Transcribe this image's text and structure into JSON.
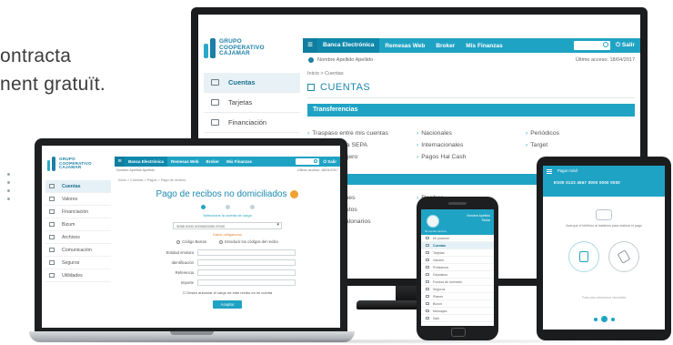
{
  "headline": {
    "line1": "ontracta",
    "line2": "nent gratuït."
  },
  "brand": {
    "name_line1": "GRUPO",
    "name_line2": "COOPERATIVO",
    "name_line3": "CAJAMAR",
    "accent_color": "#1fa3c4",
    "dark_accent_color": "#1c7fa7"
  },
  "monitor": {
    "nav": {
      "menu_icon": "hamburger-icon",
      "items": [
        "Banca Electrónica",
        "Remesas Web",
        "Broker",
        "Mis Finanzas"
      ],
      "exit_label": "Salir",
      "search_icon": "search-icon"
    },
    "user_name": "Nombre Apellido Apellido",
    "last_access": "Último acceso: 18/04/2017",
    "sidebar": [
      {
        "label": "Cuentas",
        "icon": "accounts-icon",
        "active": true
      },
      {
        "label": "Tarjetas",
        "icon": "card-icon",
        "active": false
      },
      {
        "label": "Financiación",
        "icon": "percent-icon",
        "active": false
      }
    ],
    "breadcrumb": "Inicio > Cuentas",
    "page_title": "CUENTAS",
    "section_title": "Transferencias",
    "links_col1": [
      "Traspaso entre mis cuentas",
      "Transferencia SEPA",
      "Dinero en cajero"
    ],
    "links_col2": [
      "Nacionales",
      "Internacionales",
      "Pagos Hal Cash"
    ],
    "links_col3": [
      "Periódicos",
      "Target"
    ],
    "links2_col1": [
      "Domiciliaciones",
      "Pago de tributos",
      "Gestión de talonarios"
    ],
    "links2_col2": [
      "Recibos",
      "Impuestos",
      "Cheques"
    ]
  },
  "laptop": {
    "nav": {
      "items": [
        "Banca Electrónica",
        "Remesas Web",
        "Broker",
        "Mis Finanzas"
      ],
      "exit_label": "Salir"
    },
    "user_name": "Nombre Apellido Apellido",
    "last_access": "Último acceso: 18/04/2017",
    "sidebar": [
      {
        "label": "Cuentas",
        "active": true
      },
      {
        "label": "Valores",
        "active": false
      },
      {
        "label": "Financiación",
        "active": false
      },
      {
        "label": "Bizum",
        "active": false
      },
      {
        "label": "Archivos",
        "active": false
      },
      {
        "label": "Comunicación",
        "active": false
      },
      {
        "label": "Seguros",
        "active": false
      },
      {
        "label": "Utilidades",
        "active": false
      }
    ],
    "breadcrumb": "Inicio > Cuentas > Pagos > Pago de recibos",
    "page_title": "Pago de recibos no domiciliados",
    "help_link": "Seleccione la cuenta de cargo",
    "account_select": "3058 0000 0000000000 ES00",
    "required_note": "Datos obligatorios",
    "radio_options": [
      "Código Barras",
      "Introducir los códigos del recibo"
    ],
    "form_fields": [
      "Entidad emisora",
      "Identificación",
      "Referencia",
      "Importe"
    ],
    "checkbox_text": "Deseo autorizar el cargo de este recibo en mi cuenta",
    "submit_label": "Aceptar"
  },
  "phone": {
    "user_name": "Nombre Apellido",
    "user_role": "Titular",
    "account_label": "Mi cuenta nómina",
    "menu": [
      "Mi posición",
      "Cuentas",
      "Tarjetas",
      "Valores",
      "Préstamos",
      "Depósitos",
      "Fondos de inversión",
      "Seguros",
      "Planes",
      "Bizum",
      "Mensajes",
      "Salir"
    ]
  },
  "tablet": {
    "title": "Pagar móvil",
    "account_number": "ES00 0123 4567 0000 0000 0000",
    "hand_icon": "contactless-icon",
    "instruction": "Acerque el teléfono al datáfono para realizar el pago",
    "footer_text": "Pulse para seleccionar otra tarjeta",
    "option_icons": [
      "nfc-phone-icon",
      "tap-phone-icon"
    ]
  }
}
